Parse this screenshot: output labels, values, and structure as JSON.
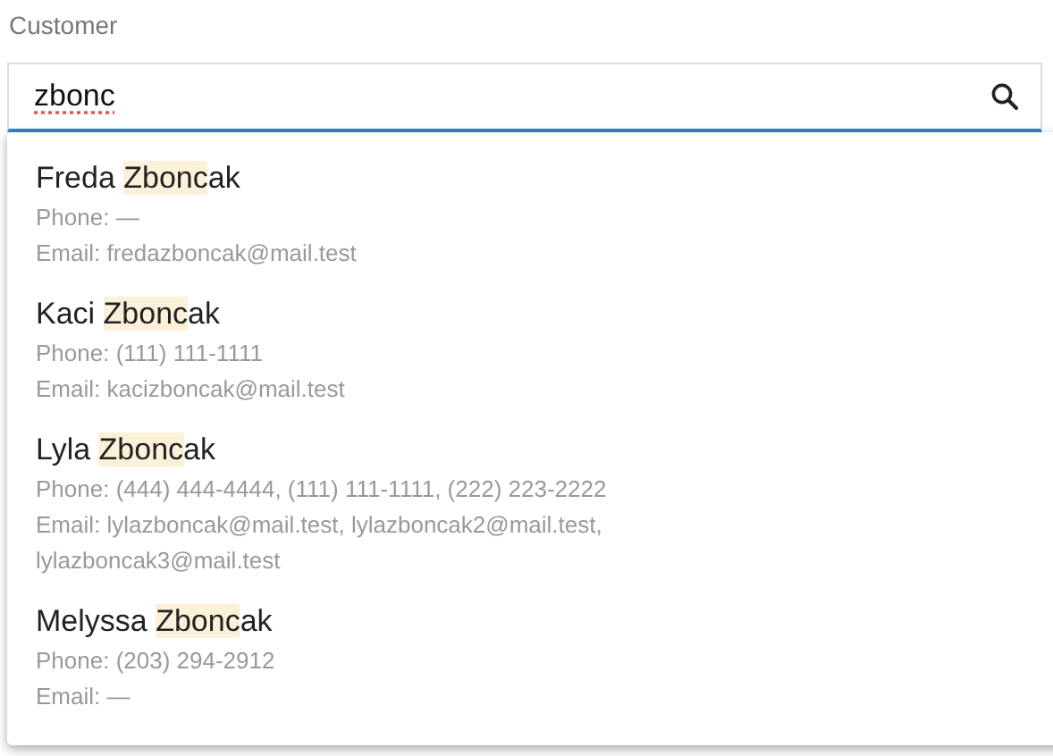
{
  "field": {
    "label": "Customer",
    "value": "zbonc"
  },
  "results": [
    {
      "first_name": "Freda",
      "match": "Zbonc",
      "rest": "ak",
      "phone": "Phone: —",
      "email": "Email: fredazboncak@mail.test"
    },
    {
      "first_name": "Kaci",
      "match": "Zbonc",
      "rest": "ak",
      "phone": "Phone: (111) 111-1111",
      "email": "Email: kacizboncak@mail.test"
    },
    {
      "first_name": "Lyla",
      "match": "Zbonc",
      "rest": "ak",
      "phone": "Phone: (444) 444-4444, (111) 111-1111, (222) 223-2222",
      "email": "Email: lylazboncak@mail.test, lylazboncak2@mail.test, lylazboncak3@mail.test"
    },
    {
      "first_name": "Melyssa",
      "match": "Zbonc",
      "rest": "ak",
      "phone": "Phone: (203) 294-2912",
      "email": "Email: —"
    }
  ]
}
